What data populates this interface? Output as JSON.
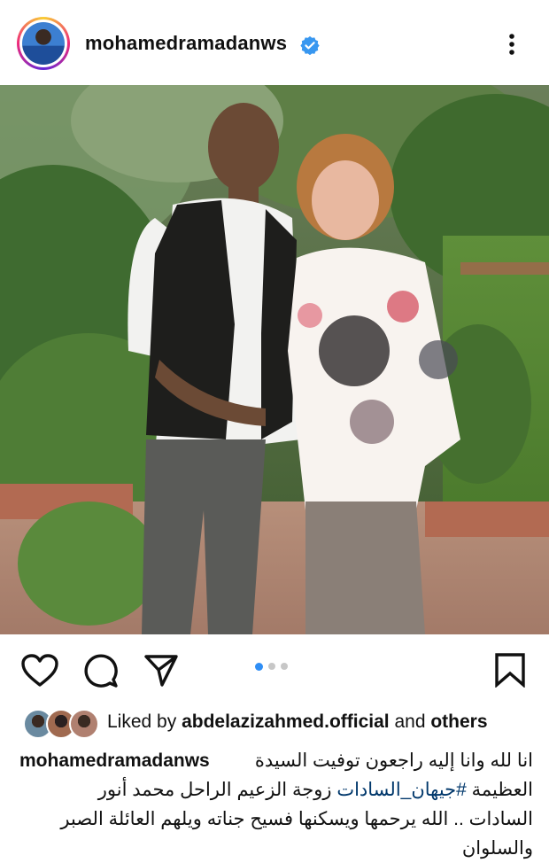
{
  "post": {
    "username": "mohamedramadanws",
    "verified": true,
    "likes": {
      "prefix": "Liked by ",
      "user": "abdelazizahmed.official",
      "and": " and ",
      "others": "others"
    },
    "caption": {
      "username": "mohamedramadanws",
      "line1": "انا لله وانا إليه راجعون توفيت السيدة",
      "line2_a": "العظيمة ",
      "hashtag": "#جيهان_السادات",
      "line2_b": " زوجة الزعيم الراحل محمد أنور",
      "line3": "السادات .. الله يرحمها ويسكنها فسيح جناته ويلهم العائلة الصبر",
      "line4": "والسلوان"
    },
    "carousel": {
      "count": 3,
      "active": 1
    }
  },
  "icons": {
    "more": "more-vertical-icon",
    "like": "heart-icon",
    "comment": "comment-icon",
    "share": "send-icon",
    "save": "bookmark-icon",
    "verified": "verified-badge-icon"
  },
  "colors": {
    "verified": "#3897f0",
    "active_dot": "#2f8ef5",
    "hashtag": "#00376b"
  }
}
